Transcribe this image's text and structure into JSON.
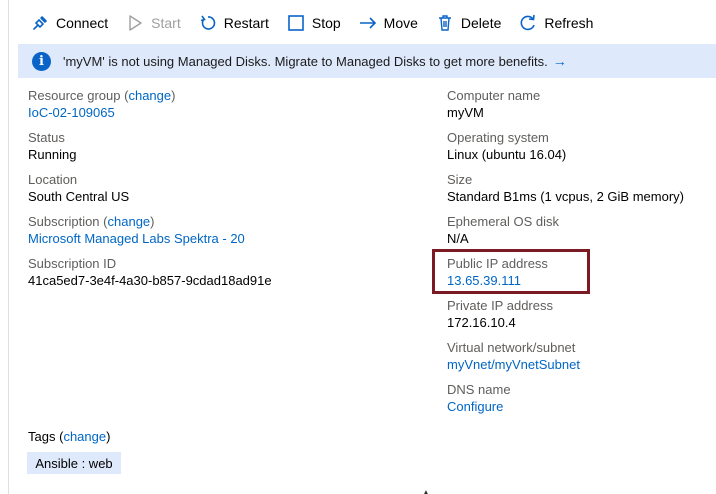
{
  "toolbar": {
    "connect": "Connect",
    "start": "Start",
    "restart": "Restart",
    "stop": "Stop",
    "move": "Move",
    "delete": "Delete",
    "refresh": "Refresh"
  },
  "banner": {
    "text": "'myVM' is not using Managed Disks. Migrate to Managed Disks to get more benefits.",
    "arrow": "→"
  },
  "essentials": {
    "resource_group": {
      "label": "Resource group",
      "change": "change",
      "value": "IoC-02-109065"
    },
    "status": {
      "label": "Status",
      "value": "Running"
    },
    "location": {
      "label": "Location",
      "value": "South Central US"
    },
    "subscription": {
      "label": "Subscription",
      "change": "change",
      "value": "Microsoft Managed Labs Spektra - 20"
    },
    "subscription_id": {
      "label": "Subscription ID",
      "value": "41ca5ed7-3e4f-4a30-b857-9cdad18ad91e"
    },
    "computer_name": {
      "label": "Computer name",
      "value": "myVM"
    },
    "os": {
      "label": "Operating system",
      "value": "Linux (ubuntu 16.04)"
    },
    "size": {
      "label": "Size",
      "value": "Standard B1ms (1 vcpus, 2 GiB memory)"
    },
    "ephemeral_os": {
      "label": "Ephemeral OS disk",
      "value": "N/A"
    },
    "public_ip": {
      "label": "Public IP address",
      "value": "13.65.39.111"
    },
    "private_ip": {
      "label": "Private IP address",
      "value": "172.16.10.4"
    },
    "vnet": {
      "label": "Virtual network/subnet",
      "value": "myVnet/myVnetSubnet"
    },
    "dns": {
      "label": "DNS name",
      "value": "Configure"
    }
  },
  "tags": {
    "label": "Tags",
    "change": "change",
    "items": [
      "Ansible : web"
    ]
  },
  "colors": {
    "link": "#0066c4",
    "banner_bg": "#dfe9fc",
    "highlight_border": "#7b1a22",
    "label": "#605e5c"
  }
}
